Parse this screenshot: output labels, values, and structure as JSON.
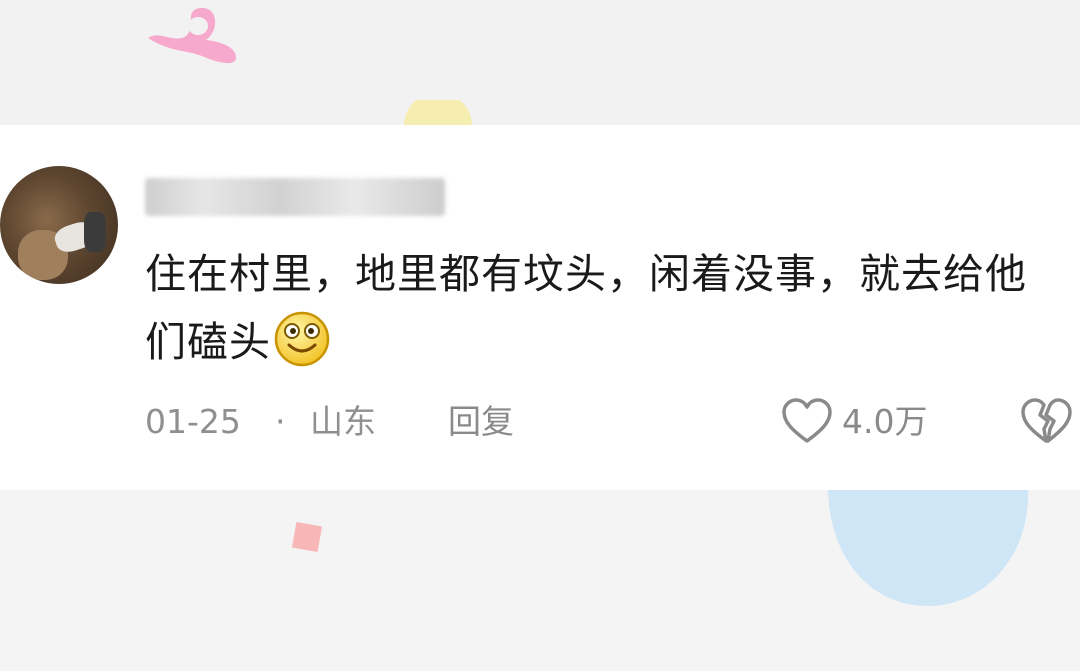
{
  "comment": {
    "username": "",
    "text": "住在村里，地里都有坟头，闲着没事，就去给他们磕头",
    "emoji_icon": "smiley-face-icon",
    "date": "01-25",
    "separator": "·",
    "location": "山东",
    "reply_label": "回复",
    "like_count": "4.0万"
  },
  "colors": {
    "card_background": "#ffffff",
    "page_background": "#f3f3f3",
    "text_primary": "#1a1a1a",
    "text_secondary": "#8f8f8f",
    "deco_pink": "#f6a9cc",
    "deco_yellow": "#f6eeb0",
    "deco_blue": "#cfe6f6",
    "deco_red": "#f7b7b7"
  }
}
